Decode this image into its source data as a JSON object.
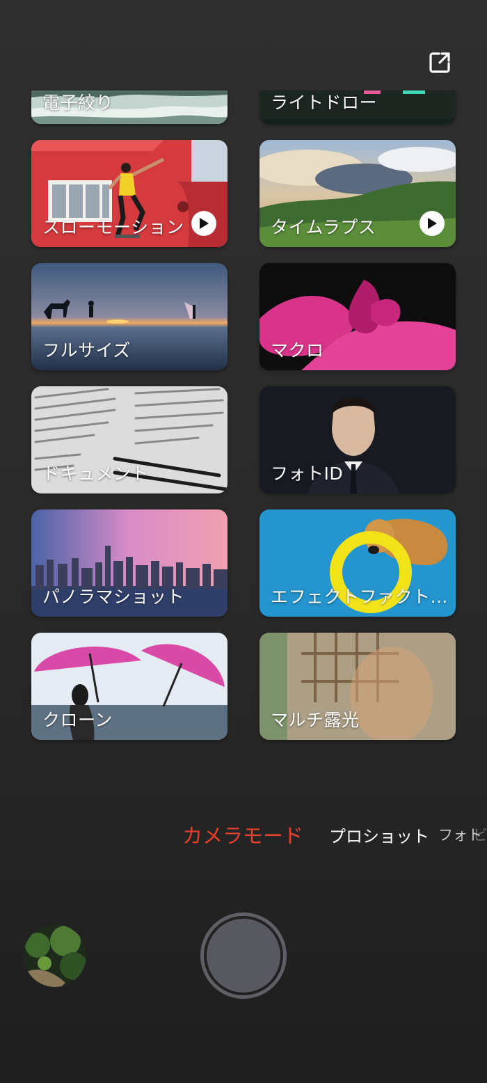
{
  "header": {
    "edit_icon": "edit-square-icon"
  },
  "modes_grid": [
    {
      "id": "electronic-aperture",
      "label": "電子絞り",
      "partial": true,
      "has_play": false
    },
    {
      "id": "light-drawing",
      "label": "ライトドロー",
      "partial": true,
      "has_play": false
    },
    {
      "id": "slow-motion",
      "label": "スローモーション",
      "partial": false,
      "has_play": true
    },
    {
      "id": "time-lapse",
      "label": "タイムラプス",
      "partial": false,
      "has_play": true
    },
    {
      "id": "full-size",
      "label": "フルサイズ",
      "partial": false,
      "has_play": false
    },
    {
      "id": "macro",
      "label": "マクロ",
      "partial": false,
      "has_play": false
    },
    {
      "id": "document",
      "label": "ドキュメント",
      "partial": false,
      "has_play": false
    },
    {
      "id": "photo-id",
      "label": "フォトID",
      "partial": false,
      "has_play": false
    },
    {
      "id": "panorama",
      "label": "パノラマショット",
      "partial": false,
      "has_play": false
    },
    {
      "id": "effect-factory",
      "label": "エフェクトファクト…",
      "partial": false,
      "has_play": false
    },
    {
      "id": "clone",
      "label": "クローン",
      "partial": false,
      "has_play": false
    },
    {
      "id": "multi-exposure",
      "label": "マルチ露光",
      "partial": false,
      "has_play": false
    }
  ],
  "mode_bar": {
    "active": "カメラモード",
    "next": "プロショット",
    "far": "フォト",
    "faded": "ビ"
  },
  "colors": {
    "active_mode": "#e8402a",
    "background": "#2b2b2b"
  }
}
